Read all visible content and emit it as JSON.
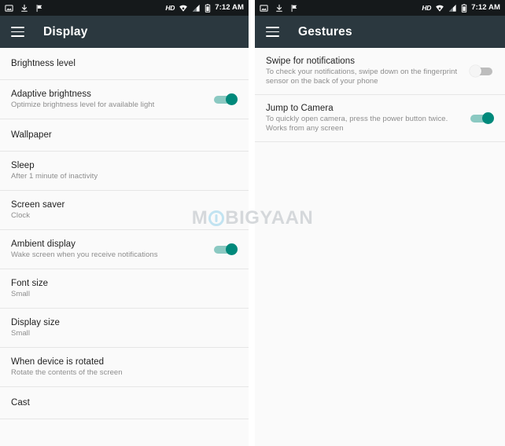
{
  "status_bar": {
    "icons_left": [
      "image-icon",
      "download-icon",
      "flag-icon"
    ],
    "hd_label": "HD",
    "icons_right": [
      "wifi-icon",
      "signal-icon",
      "battery-icon"
    ],
    "time": "7:12 AM"
  },
  "watermark": {
    "part1": "M",
    "part2": "BIGYAAN"
  },
  "screens": [
    {
      "toolbar": {
        "menu_icon": "hamburger-menu-icon",
        "title": "Display"
      },
      "rows": [
        {
          "title": "Brightness level",
          "subtitle": "",
          "toggle": null
        },
        {
          "title": "Adaptive brightness",
          "subtitle": "Optimize brightness level for available light",
          "toggle": "on"
        },
        {
          "title": "Wallpaper",
          "subtitle": "",
          "toggle": null
        },
        {
          "title": "Sleep",
          "subtitle": "After 1 minute of inactivity",
          "toggle": null
        },
        {
          "title": "Screen saver",
          "subtitle": "Clock",
          "toggle": null
        },
        {
          "title": "Ambient display",
          "subtitle": "Wake screen when you receive notifications",
          "toggle": "on"
        },
        {
          "title": "Font size",
          "subtitle": "Small",
          "toggle": null
        },
        {
          "title": "Display size",
          "subtitle": "Small",
          "toggle": null
        },
        {
          "title": "When device is rotated",
          "subtitle": "Rotate the contents of the screen",
          "toggle": null
        },
        {
          "title": "Cast",
          "subtitle": "",
          "toggle": null
        }
      ]
    },
    {
      "toolbar": {
        "menu_icon": "hamburger-menu-icon",
        "title": "Gestures"
      },
      "rows": [
        {
          "title": "Swipe for notifications",
          "subtitle": "To check your notifications, swipe down on the fingerprint sensor on the back of your phone",
          "toggle": "off"
        },
        {
          "title": "Jump to Camera",
          "subtitle": "To quickly open camera, press the power button twice. Works from any screen",
          "toggle": "on"
        }
      ]
    }
  ],
  "colors": {
    "status_bar": "#15191b",
    "toolbar": "#2b383f",
    "list_background": "#fafafa",
    "divider": "#e6e6e6",
    "toggle_on": "#00897b",
    "toggle_on_track": "#8bc9c2",
    "toggle_off_track": "#bdbdbd",
    "title_text": "#1f1f1f",
    "subtitle_text": "#8d8d8d"
  }
}
